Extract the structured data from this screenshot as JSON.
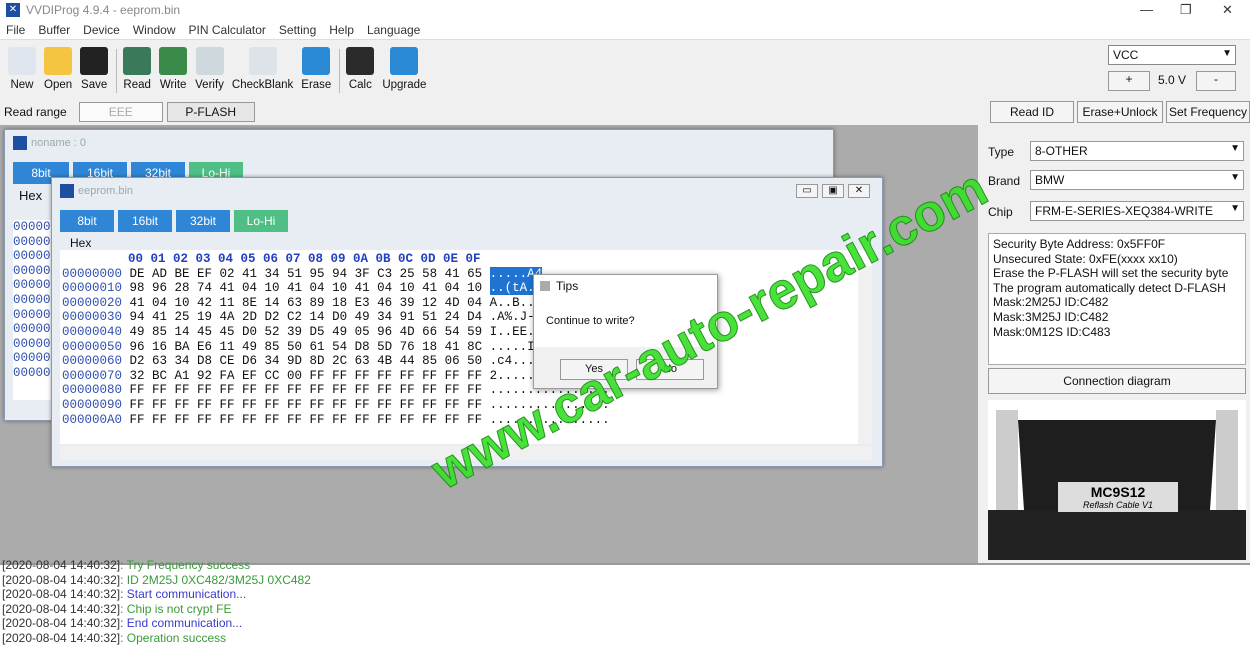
{
  "window": {
    "title": "VVDIProg 4.9.4 - eeprom.bin",
    "min": "—",
    "max": "❐",
    "close": "✕"
  },
  "menu": [
    "File",
    "Buffer",
    "Device",
    "Window",
    "PIN Calculator",
    "Setting",
    "Help",
    "Language"
  ],
  "toolbar": [
    {
      "label": "New",
      "icon": "new-file-icon",
      "color": "#dfe6ee"
    },
    {
      "label": "Open",
      "icon": "folder-icon",
      "color": "#f5c542"
    },
    {
      "label": "Save",
      "icon": "save-icon",
      "color": "#222"
    },
    {
      "label": "Read",
      "icon": "read-chip-icon",
      "color": "#3a7a5a"
    },
    {
      "label": "Write",
      "icon": "write-chip-icon",
      "color": "#3a8a4a"
    },
    {
      "label": "Verify",
      "icon": "verify-icon",
      "color": "#cfd8dc"
    },
    {
      "label": "CheckBlank",
      "icon": "checkblank-icon",
      "color": "#dde3e8"
    },
    {
      "label": "Erase",
      "icon": "erase-icon",
      "color": "#2a8ad6"
    },
    {
      "label": "Calc",
      "icon": "calculator-icon",
      "color": "#2b2b2b"
    },
    {
      "label": "Upgrade",
      "icon": "upgrade-arrow-icon",
      "color": "#2a8ad6"
    }
  ],
  "power": {
    "select": "VCC",
    "plus": "+",
    "voltage": "5.0 V",
    "minus": "-"
  },
  "read_range": {
    "label": "Read range",
    "eee": "EEE",
    "pflash": "P-FLASH"
  },
  "actions": {
    "read_id": "Read ID",
    "erase_unlock": "Erase+Unlock",
    "set_frequency": "Set Frequency"
  },
  "bg_window": {
    "title": "noname : 0",
    "tabs": [
      "8bit",
      "16bit",
      "32bit",
      "Lo-Hi"
    ],
    "group": "Hex",
    "addr_stub": [
      "00000",
      "00000",
      "00000",
      "00000",
      "00000",
      "00000",
      "00000",
      "00000",
      "00000",
      "00000",
      "00000"
    ]
  },
  "editor": {
    "title": "eeprom.bin",
    "tabs": [
      "8bit",
      "16bit",
      "32bit",
      "Lo-Hi"
    ],
    "group": "Hex",
    "header": "00 01 02 03 04 05 06 07 08 09 0A 0B 0C 0D 0E 0F",
    "rows": [
      {
        "addr": "00000000",
        "hex": "DE AD BE EF 02 41 34 51 95 94 3F C3 25 58 41 65",
        "ascii": ".....A4"
      },
      {
        "addr": "00000010",
        "hex": "98 96 28 74 41 04 10 41 04 10 41 04 10 41 04 10",
        "ascii": "..(tA..A"
      },
      {
        "addr": "00000020",
        "hex": "41 04 10 42 11 8E 14 63 89 18 E3 46 39 12 4D 04",
        "ascii": "A..B...c"
      },
      {
        "addr": "00000030",
        "hex": "94 41 25 19 4A 2D D2 C2 14 D0 49 34 91 51 24 D4",
        "ascii": ".A%.J-.."
      },
      {
        "addr": "00000040",
        "hex": "49 85 14 45 45 D0 52 39 D5 49 05 96 4D 66 54 59",
        "ascii": "I..EE.R9"
      },
      {
        "addr": "00000050",
        "hex": "96 16 BA E6 11 49 85 50 61 54 D8 5D 76 18 41 8C",
        "ascii": ".....I.P"
      },
      {
        "addr": "00000060",
        "hex": "D2 63 34 D8 CE D6 34 9D 8D 2C 63 4B 44 85 06 50",
        "ascii": ".c4...4."
      },
      {
        "addr": "00000070",
        "hex": "32 BC A1 92 FA EF CC 00 FF FF FF FF FF FF FF FF",
        "ascii": "2......."
      },
      {
        "addr": "00000080",
        "hex": "FF FF FF FF FF FF FF FF FF FF FF FF FF FF FF FF",
        "ascii": "................"
      },
      {
        "addr": "00000090",
        "hex": "FF FF FF FF FF FF FF FF FF FF FF FF FF FF FF FF",
        "ascii": "................"
      },
      {
        "addr": "000000A0",
        "hex": "FF FF FF FF FF FF FF FF FF FF FF FF FF FF FF FF",
        "ascii": "................"
      }
    ]
  },
  "dialog": {
    "title": "Tips",
    "message": "Continue to write?",
    "yes": "Yes",
    "no": "No"
  },
  "chip": {
    "type_label": "Type",
    "type": "8-OTHER",
    "brand_label": "Brand",
    "brand": "BMW",
    "chip_label": "Chip",
    "chip": "FRM-E-SERIES-XEQ384-WRITE"
  },
  "info": [
    "Security Byte Address: 0x5FF0F",
    "Unsecured State: 0xFE(xxxx xx10)",
    "Erase the P-FLASH will set the security byte",
    "The program automatically detect D-FLASH",
    "Mask:2M25J ID:C482",
    "Mask:3M25J ID:C482",
    "Mask:0M12S ID:C483"
  ],
  "connection_diagram": "Connection diagram",
  "cable": {
    "name": "MC9S12",
    "sub": "Reflash Cable V1"
  },
  "log": [
    {
      "time": "[2020-08-04 14:40:32]",
      "msg": ": Try Frequency success",
      "cls": "g"
    },
    {
      "time": "[2020-08-04 14:40:32]",
      "msg": ": ID  2M25J 0XC482/3M25J 0XC482",
      "cls": "g"
    },
    {
      "time": "[2020-08-04 14:40:32]",
      "msg": ": Start communication...",
      "cls": "b"
    },
    {
      "time": "[2020-08-04 14:40:32]",
      "msg": ": Chip is not crypt FE",
      "cls": "g"
    },
    {
      "time": "[2020-08-04 14:40:32]",
      "msg": ": End communication...",
      "cls": "b"
    },
    {
      "time": "[2020-08-04 14:40:32]",
      "msg": ": Operation success",
      "cls": "g"
    }
  ],
  "watermark": "www.car-auto-repair.com"
}
